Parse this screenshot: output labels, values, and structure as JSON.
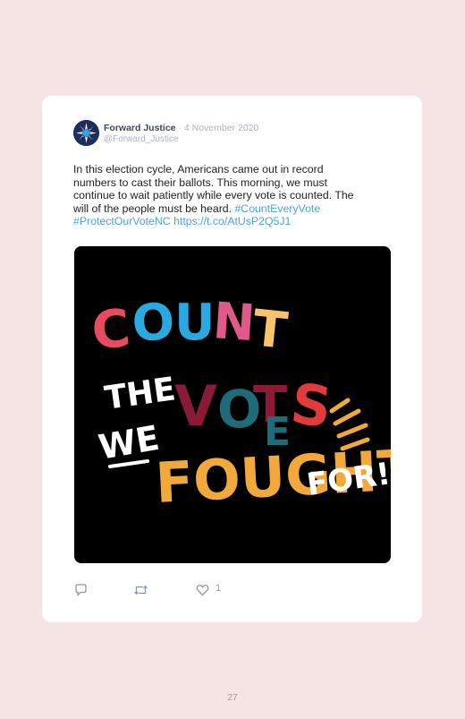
{
  "tweet": {
    "author_name": "Forward Justice",
    "separator": "·",
    "date": "4 November 2020",
    "handle": "@Forward_Justice",
    "text_line1": "In this election cycle, Americans came out in record",
    "text_line2": "numbers to cast their ballots. This morning, we must",
    "text_line3": "continue to wait patiently while every vote is counted. The",
    "text_line4": "will of the people must be heard.",
    "hashtag1": "#CountEveryVote",
    "hashtag2": "#ProtectOurVoteNC",
    "link": "https://t.co/AtUsP2Q5J1",
    "like_count": "1"
  },
  "media": {
    "word1": "COUNT",
    "word2": "THE",
    "word3": "VOTES",
    "word4": "WE",
    "word5": "FOUGHT",
    "word6": "FOR!"
  },
  "icons": {
    "avatar": "forward-justice-logo",
    "reply": "reply-icon",
    "retweet": "retweet-icon",
    "like": "heart-icon"
  },
  "colors": {
    "page_background": "#f5e4e3",
    "link": "#4aa3df",
    "count_red": "#e84a5f",
    "count_blue": "#29a9e0",
    "count_pink": "#e0598b",
    "count_yellow": "#f7c36b",
    "votes_maroon": "#8a1b36",
    "votes_teal": "#1e6b7a",
    "votes_red": "#e23b3b",
    "fought_orange": "#f2a93b"
  },
  "page": {
    "number": "27"
  }
}
